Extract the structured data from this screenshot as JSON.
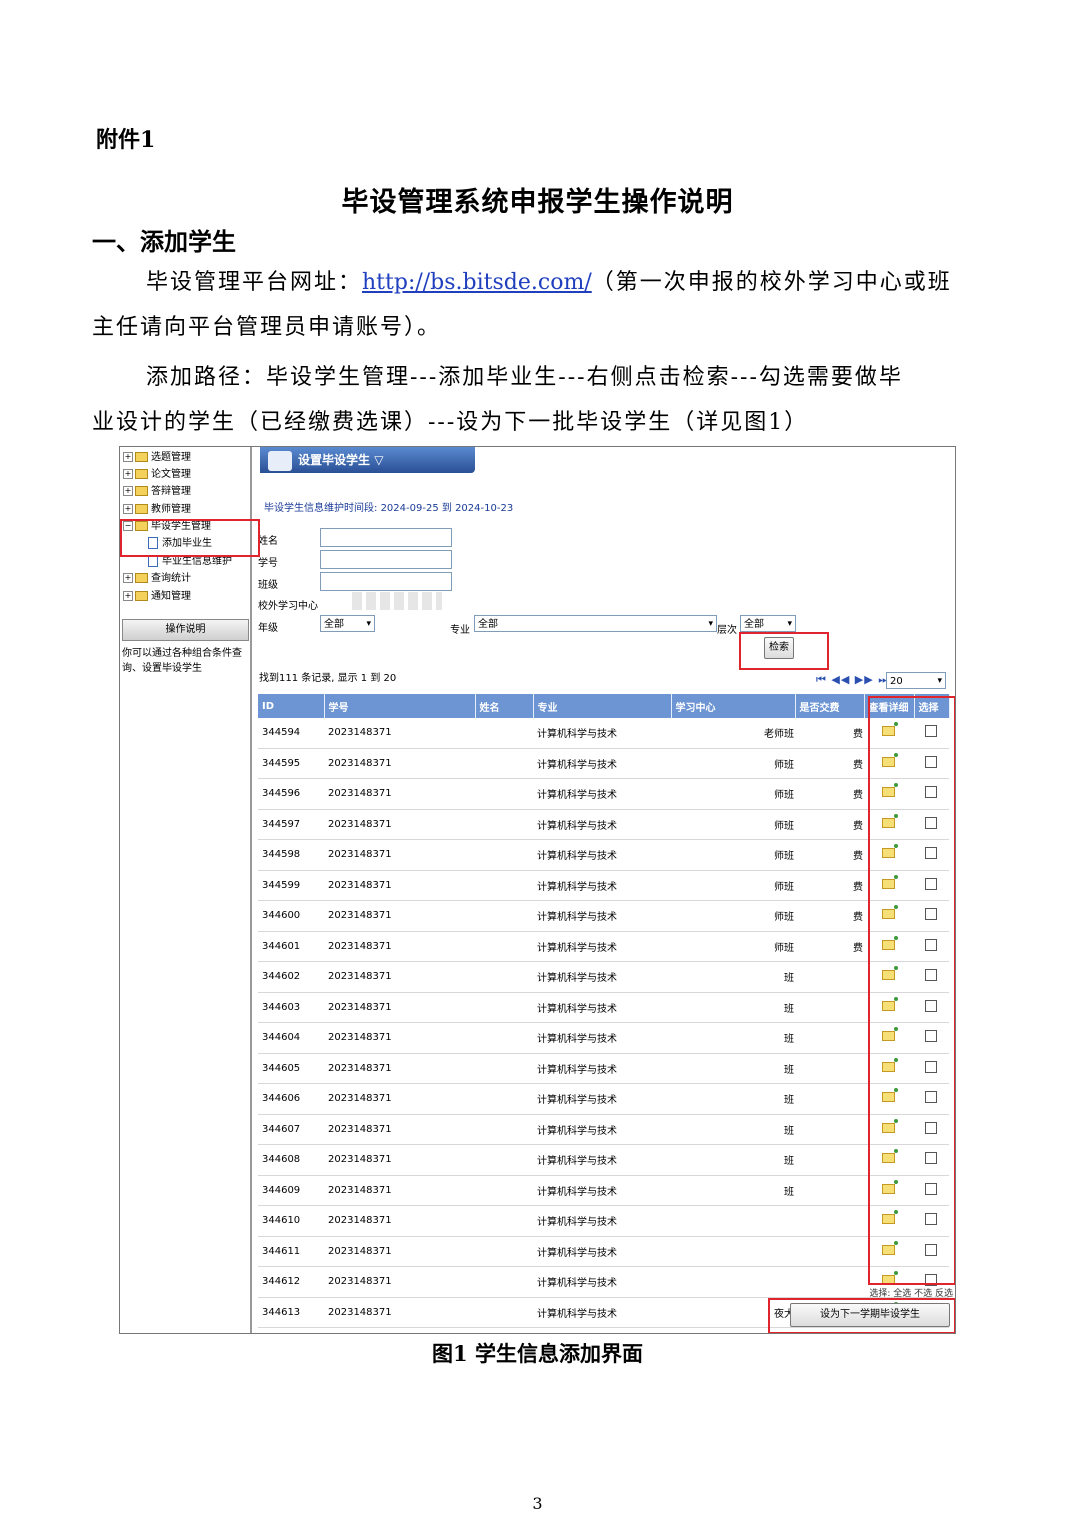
{
  "doc": {
    "annex": "附件1",
    "title": "毕设管理系统申报学生操作说明",
    "section_heading": "一、添加学生",
    "para1_prefix": "毕设管理平台网址：",
    "para1_link": "http://bs.bitsde.com/",
    "para1_suffix": "（第一次申报的校外学习中心或班",
    "para1_line2": "主任请向平台管理员申请账号）。",
    "para2_line1": "添加路径：毕设学生管理---添加毕业生---右侧点击检索---勾选需要做毕",
    "para2_line2": "业设计的学生（已经缴费选课）---设为下一批毕设学生（详见图1）",
    "caption": "图1 学生信息添加界面",
    "page_number": "3"
  },
  "sidebar": {
    "items": [
      {
        "label": "选题管理",
        "toggle": "+"
      },
      {
        "label": "论文管理",
        "toggle": "+"
      },
      {
        "label": "答辩管理",
        "toggle": "+"
      },
      {
        "label": "教师管理",
        "toggle": "+"
      },
      {
        "label": "毕设学生管理",
        "toggle": "−"
      },
      {
        "label": "添加毕业生",
        "toggle": ""
      },
      {
        "label": "毕业生信息维护",
        "toggle": ""
      },
      {
        "label": "查询统计",
        "toggle": "+"
      },
      {
        "label": "通知管理",
        "toggle": "+"
      }
    ],
    "help_title": "操作说明",
    "help_text": "你可以通过各种组合条件查询、设置毕设学生"
  },
  "main": {
    "title_tab": "设置毕设学生",
    "period_label": "毕设学生信息维护时间段:",
    "period_start": "2024-09-25",
    "period_to": "到",
    "period_end": "2024-10-23",
    "fields": {
      "name": "姓名",
      "student_id": "学号",
      "class": "班级",
      "center": "校外学习中心",
      "grade": "年级",
      "major": "专业",
      "level": "层次"
    },
    "grade_value": "全部",
    "major_value": "全部",
    "level_value": "全部",
    "search_button": "检索",
    "records_text": "找到111 条记录, 显示 1 到 20",
    "pager_icons": "⏮ ◀◀ ▶▶ ⏭",
    "page_size": "20",
    "columns": [
      "ID",
      "学号",
      "姓名",
      "专业",
      "学习中心",
      "是否交费",
      "查看详细",
      "选择"
    ],
    "rows": [
      {
        "id": "344594",
        "sno": "2023148371",
        "major": "计算机科学与技术",
        "center": "老师班",
        "paid": "费"
      },
      {
        "id": "344595",
        "sno": "2023148371",
        "major": "计算机科学与技术",
        "center": "师班",
        "paid": "费"
      },
      {
        "id": "344596",
        "sno": "2023148371",
        "major": "计算机科学与技术",
        "center": "师班",
        "paid": "费"
      },
      {
        "id": "344597",
        "sno": "2023148371",
        "major": "计算机科学与技术",
        "center": "师班",
        "paid": "费"
      },
      {
        "id": "344598",
        "sno": "2023148371",
        "major": "计算机科学与技术",
        "center": "师班",
        "paid": "费"
      },
      {
        "id": "344599",
        "sno": "2023148371",
        "major": "计算机科学与技术",
        "center": "师班",
        "paid": "费"
      },
      {
        "id": "344600",
        "sno": "2023148371",
        "major": "计算机科学与技术",
        "center": "师班",
        "paid": "费"
      },
      {
        "id": "344601",
        "sno": "2023148371",
        "major": "计算机科学与技术",
        "center": "师班",
        "paid": "费"
      },
      {
        "id": "344602",
        "sno": "2023148371",
        "major": "计算机科学与技术",
        "center": "班",
        "paid": ""
      },
      {
        "id": "344603",
        "sno": "2023148371",
        "major": "计算机科学与技术",
        "center": "班",
        "paid": ""
      },
      {
        "id": "344604",
        "sno": "2023148371",
        "major": "计算机科学与技术",
        "center": "班",
        "paid": ""
      },
      {
        "id": "344605",
        "sno": "2023148371",
        "major": "计算机科学与技术",
        "center": "班",
        "paid": ""
      },
      {
        "id": "344606",
        "sno": "2023148371",
        "major": "计算机科学与技术",
        "center": "班",
        "paid": ""
      },
      {
        "id": "344607",
        "sno": "2023148371",
        "major": "计算机科学与技术",
        "center": "班",
        "paid": ""
      },
      {
        "id": "344608",
        "sno": "2023148371",
        "major": "计算机科学与技术",
        "center": "班",
        "paid": ""
      },
      {
        "id": "344609",
        "sno": "2023148371",
        "major": "计算机科学与技术",
        "center": "班",
        "paid": ""
      },
      {
        "id": "344610",
        "sno": "2023148371",
        "major": "计算机科学与技术",
        "center": "",
        "paid": ""
      },
      {
        "id": "344611",
        "sno": "2023148371",
        "major": "计算机科学与技术",
        "center": "",
        "paid": ""
      },
      {
        "id": "344612",
        "sno": "2023148371",
        "major": "计算机科学与技术",
        "center": "",
        "paid": ""
      },
      {
        "id": "344613",
        "sno": "2023148371",
        "major": "计算机科学与技术",
        "center": "夜大",
        "paid": ""
      }
    ],
    "select_links": "选择: 全选 不选 反选",
    "set_next_button": "设为下一学期毕设学生"
  },
  "colors": {
    "accent_red": "#e0242c",
    "header_blue": "#6d95d3",
    "link_blue": "#1f3fbf"
  }
}
